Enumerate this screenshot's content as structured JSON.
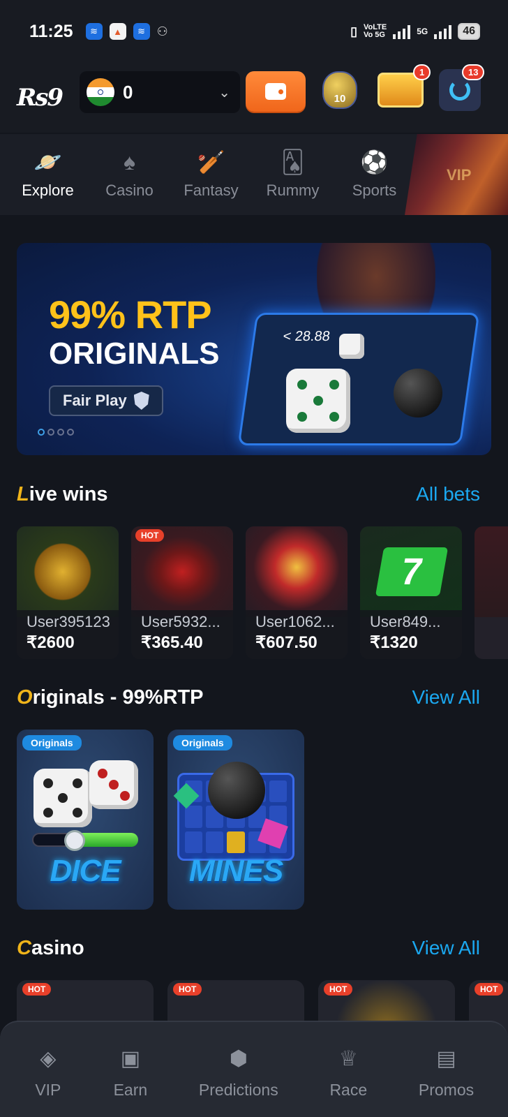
{
  "status_bar": {
    "time": "11:25",
    "network_top": "VoLTE",
    "network_bottom": "Vo 5G",
    "data_label": "5G",
    "battery": "46"
  },
  "header": {
    "logo": "Rs9",
    "balance": "0",
    "notification_count": "1",
    "support_count": "13",
    "pot_level": "10"
  },
  "tabs": [
    {
      "label": "Explore",
      "icon": "planet-icon",
      "active": true
    },
    {
      "label": "Casino",
      "icon": "spade-icon"
    },
    {
      "label": "Fantasy",
      "icon": "cricket-bat-icon"
    },
    {
      "label": "Rummy",
      "icon": "cards-icon"
    },
    {
      "label": "Sports",
      "icon": "football-icon"
    }
  ],
  "vip_promo_text": "VIP",
  "banner": {
    "line1": "99% RTP",
    "line2": "ORIGINALS",
    "fair_play": "Fair Play",
    "panel_odds": "< 28.88",
    "slide_count": 4,
    "active_slide": 1
  },
  "live_wins": {
    "title_first": "L",
    "title_rest": "ive wins",
    "link": "All bets",
    "items": [
      {
        "user": "User395123",
        "amount": "₹2600",
        "hot": false
      },
      {
        "user": "User5932...",
        "amount": "₹365.40",
        "hot": true,
        "hot_label": "HOT"
      },
      {
        "user": "User1062...",
        "amount": "₹607.50",
        "hot": false
      },
      {
        "user": "User849...",
        "amount": "₹1320",
        "hot": false
      }
    ]
  },
  "originals": {
    "title_first": "O",
    "title_rest": "riginals - 99%RTP",
    "link": "View All",
    "items": [
      {
        "tag": "Originals",
        "title": "DICE"
      },
      {
        "tag": "Originals",
        "title": "MINES"
      }
    ]
  },
  "casino": {
    "title_first": "C",
    "title_rest": "asino",
    "link": "View All",
    "hot_label": "HOT"
  },
  "bottom_nav": [
    {
      "label": "VIP",
      "icon": "diamond-icon"
    },
    {
      "label": "Earn",
      "icon": "ticket-icon"
    },
    {
      "label": "Predictions",
      "icon": "ab-hexagon-icon"
    },
    {
      "label": "Race",
      "icon": "trophy-icon"
    },
    {
      "label": "Promos",
      "icon": "gift-icon"
    }
  ],
  "colors": {
    "accent_blue": "#1ba8f0",
    "accent_gold": "#f0b41a",
    "hot_red": "#e8402a",
    "wallet_orange": "#f0661b",
    "background": "#13161d"
  }
}
